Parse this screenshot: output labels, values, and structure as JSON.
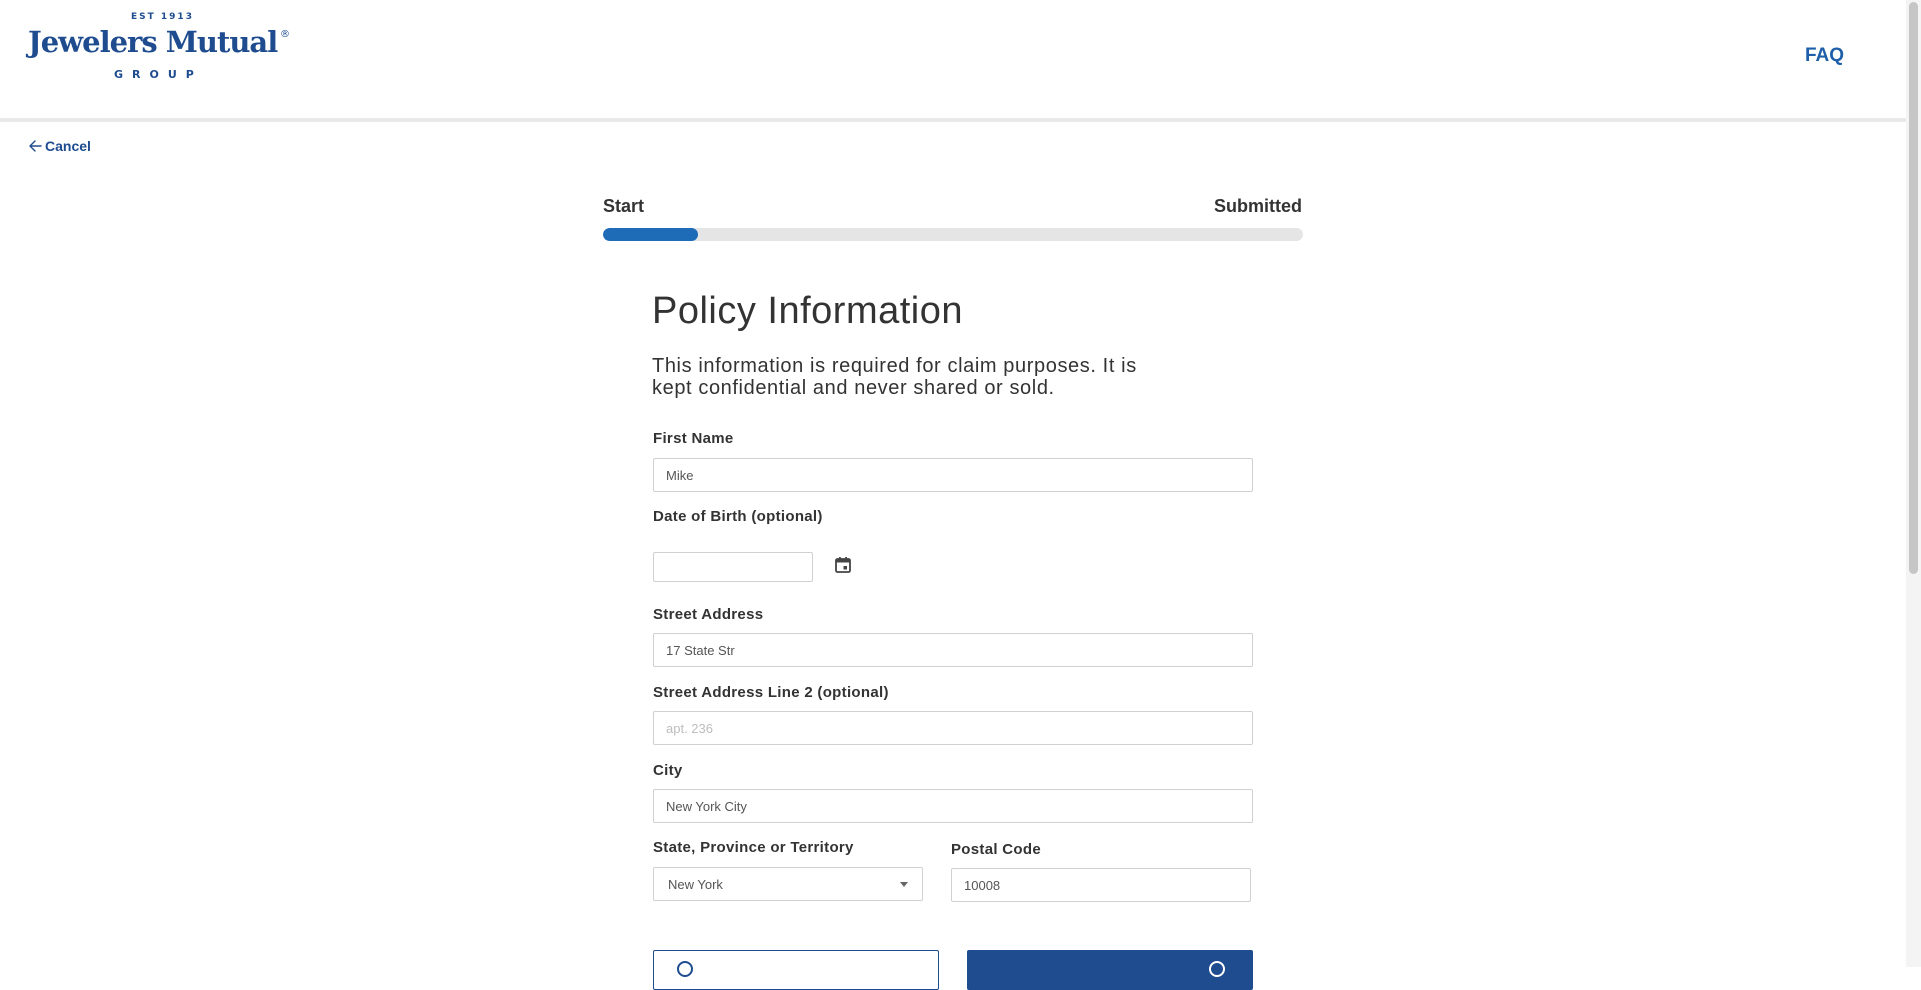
{
  "header": {
    "logo": {
      "est": "EST 1913",
      "name": "Jewelers Mutual",
      "registered": "®",
      "group": "GROUP"
    },
    "faq_label": "FAQ"
  },
  "nav": {
    "cancel_label": "Cancel"
  },
  "progress": {
    "start_label": "Start",
    "end_label": "Submitted",
    "fraction": 0.136
  },
  "form": {
    "title": "Policy Information",
    "intro": "This information is required for claim purposes. It is kept confidential and never shared or sold.",
    "first_name": {
      "label": "First Name",
      "value": "Mike"
    },
    "date_of_birth": {
      "label": "Date of Birth (optional)",
      "value": ""
    },
    "street_address": {
      "label": "Street Address",
      "value": "17 State Str"
    },
    "street_address_2": {
      "label": "Street Address Line 2 (optional)",
      "value": "",
      "placeholder": "apt. 236"
    },
    "city": {
      "label": "City",
      "value": "New York City"
    },
    "state": {
      "label": "State, Province or Territory",
      "value": "New York"
    },
    "postal_code": {
      "label": "Postal Code",
      "value": "10008"
    }
  },
  "colors": {
    "brand": "#1e4c8f",
    "progress_fill": "#1e6bb8",
    "progress_track": "#e5e5e5"
  }
}
